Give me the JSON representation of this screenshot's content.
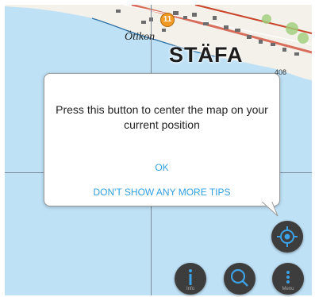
{
  "map": {
    "places": {
      "otikon": "Ötikon",
      "stafa": "STÄFA"
    },
    "elevation": "408",
    "poi_icon": "restaurant-poi-icon",
    "poi_glyph": "11"
  },
  "tip": {
    "message": "Press this button to center the map on your current position",
    "ok_label": "OK",
    "no_more_tips_label": "DON'T SHOW ANY MORE TIPS"
  },
  "controls": {
    "center_button_icon": "gps-target-icon",
    "info_button_icon": "info-icon",
    "info_label": "Info",
    "search_button_icon": "search-icon",
    "menu_button_icon": "more-vertical-icon",
    "menu_label": "Menu"
  },
  "colors": {
    "water": "#bfe1f6",
    "accent": "#2f9fe0",
    "fab": "#3d3d3d"
  }
}
